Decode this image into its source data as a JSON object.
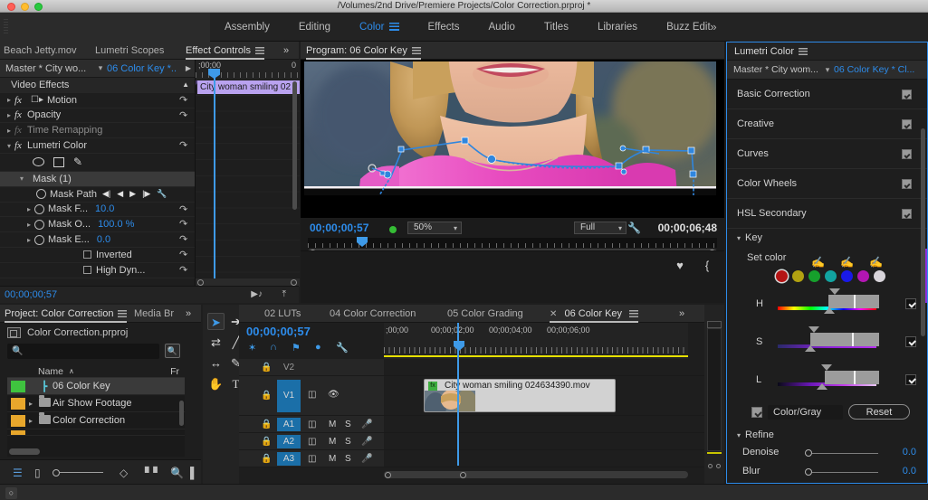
{
  "window": {
    "title": "/Volumes/2nd Drive/Premiere Projects/Color Correction.prproj *"
  },
  "workspace": {
    "tabs": [
      {
        "label": "Assembly",
        "active": false
      },
      {
        "label": "Editing",
        "active": false
      },
      {
        "label": "Color",
        "active": true
      },
      {
        "label": "Effects",
        "active": false
      },
      {
        "label": "Audio",
        "active": false
      },
      {
        "label": "Titles",
        "active": false
      },
      {
        "label": "Libraries",
        "active": false
      },
      {
        "label": "Buzz Edit",
        "active": false
      }
    ],
    "overflow": "»"
  },
  "effect_controls": {
    "tabs": [
      {
        "label": "Beach Jetty.mov",
        "active": false
      },
      {
        "label": "Lumetri Scopes",
        "active": false
      },
      {
        "label": "Effect Controls",
        "active": true
      }
    ],
    "overflow": "»",
    "master_label": "Master * City wo...",
    "sequence_label": "06 Color Key *...",
    "section_header": "Video Effects",
    "rows": [
      {
        "label": "Motion",
        "kind": "fx",
        "value": ""
      },
      {
        "label": "Opacity",
        "kind": "fx",
        "value": ""
      },
      {
        "label": "Time Remapping",
        "kind": "fx-dim",
        "value": ""
      },
      {
        "label": "Lumetri Color",
        "kind": "fx-open",
        "value": ""
      }
    ],
    "mask_label": "Mask (1)",
    "mask_path_label": "Mask Path",
    "params": [
      {
        "label": "Mask F...",
        "value": "10.0"
      },
      {
        "label": "Mask O...",
        "value": "100.0 %"
      },
      {
        "label": "Mask E...",
        "value": "0.0"
      }
    ],
    "checkboxes": [
      {
        "label": "Inverted",
        "checked": false
      },
      {
        "label": "High Dyn...",
        "checked": false
      }
    ],
    "timeline_start": ";00;00",
    "timeline_end": "0",
    "clip_label": "City woman smiling 02",
    "timecode": "00;00;00;57"
  },
  "program": {
    "tab_label": "Program: 06 Color Key",
    "timecode_left": "00;00;00;57",
    "zoom_level": "50%",
    "quality": "Full",
    "duration": "00;00;06;48",
    "buttons": [
      {
        "name": "add-marker-button",
        "glyph": "♥"
      },
      {
        "name": "mark-in-button",
        "glyph": "{"
      },
      {
        "name": "mark-out-button",
        "glyph": "}"
      },
      {
        "name": "go-to-in-button",
        "glyph": "{←"
      },
      {
        "name": "step-back-button",
        "glyph": "◀❘"
      },
      {
        "name": "play-stop-button",
        "glyph": "▶"
      },
      {
        "name": "step-forward-button",
        "glyph": "❘▶"
      },
      {
        "name": "go-to-out-button",
        "glyph": "→}"
      },
      {
        "name": "lift-button",
        "glyph": "▃"
      },
      {
        "name": "extract-button",
        "glyph": "▃"
      },
      {
        "name": "export-frame-button",
        "glyph": "▣"
      },
      {
        "name": "button-editor-overflow",
        "glyph": "»"
      },
      {
        "name": "add-button",
        "glyph": "+"
      }
    ]
  },
  "lumetri": {
    "tab_label": "Lumetri Color",
    "master_label": "Master * City wom...",
    "sequence_label": "06 Color Key * Cl...",
    "sections": [
      {
        "label": "Basic Correction",
        "checked": true
      },
      {
        "label": "Creative",
        "checked": true
      },
      {
        "label": "Curves",
        "checked": true
      },
      {
        "label": "Color Wheels",
        "checked": true
      },
      {
        "label": "HSL Secondary",
        "checked": true
      }
    ],
    "key_label": "Key",
    "set_color_label": "Set color",
    "eyedroppers": [
      "eyedropper",
      "eyedropper-add",
      "eyedropper-subtract"
    ],
    "swatches": [
      {
        "name": "red",
        "color": "#b41414",
        "selected": true
      },
      {
        "name": "yellow",
        "color": "#b2a211"
      },
      {
        "name": "green",
        "color": "#16a02c"
      },
      {
        "name": "cyan",
        "color": "#12a3a0"
      },
      {
        "name": "blue",
        "color": "#1919e8"
      },
      {
        "name": "magenta",
        "color": "#b316b3"
      },
      {
        "name": "white",
        "color": "#d8d4da"
      }
    ],
    "hsl_rows": [
      {
        "label": "H",
        "checked": true
      },
      {
        "label": "S",
        "checked": true
      },
      {
        "label": "L",
        "checked": true
      }
    ],
    "color_gray_label": "Color/Gray",
    "color_gray_checked": true,
    "reset_label": "Reset",
    "refine_label": "Refine",
    "refine_sliders": [
      {
        "label": "Denoise",
        "value": "0.0"
      },
      {
        "label": "Blur",
        "value": "0.0"
      }
    ]
  },
  "project": {
    "tabs": [
      {
        "label": "Project: Color Correction",
        "active": true
      },
      {
        "label": "Media Br",
        "active": false
      }
    ],
    "overflow": "»",
    "project_file": "Color Correction.prproj",
    "search_placeholder": "",
    "columns": {
      "name": "Name",
      "sort": "∧",
      "second": "Fr"
    },
    "items": [
      {
        "label": "06 Color Key",
        "type": "sequence",
        "swatch": "#3fc33f",
        "selected": true,
        "expandable": false
      },
      {
        "label": "Air Show Footage",
        "type": "bin",
        "swatch": "#e8a72c",
        "selected": false,
        "expandable": true
      },
      {
        "label": "Color Correction",
        "type": "bin",
        "swatch": "#e8a72c",
        "selected": false,
        "expandable": true
      }
    ],
    "footer_icons": [
      "list-view-icon",
      "icon-view-icon",
      "zoom-slider",
      "sort-icon",
      "freeform-icon",
      "find-icon",
      "new-item-icon"
    ]
  },
  "timeline": {
    "tabs": [
      {
        "label": "02 LUTs",
        "active": false,
        "closable": false
      },
      {
        "label": "04 Color Correction",
        "active": false,
        "closable": false
      },
      {
        "label": "05 Color Grading",
        "active": false,
        "closable": false
      },
      {
        "label": "06 Color Key",
        "active": true,
        "closable": true
      }
    ],
    "overflow": "»",
    "timecode": "00;00;00;57",
    "tool_icons": [
      "selection-tool",
      "track-select-forward-tool",
      "ripple-edit-tool",
      "rolling-edit-tool",
      "slip-tool",
      "pen-tool",
      "hand-tool",
      "type-tool"
    ],
    "toolbar_icons": [
      "nest-toggle-icon",
      "snap-icon",
      "linked-selection-icon",
      "add-marker-icon",
      "timeline-settings-icon"
    ],
    "ruler_labels": [
      ";00;00",
      "00;00;02;00",
      "00;00;04;00",
      "00;00;06;00"
    ],
    "tracks": [
      {
        "name": "V2",
        "type": "video",
        "enabled": false
      },
      {
        "name": "V1",
        "type": "video",
        "enabled": true
      },
      {
        "name": "A1",
        "type": "audio",
        "enabled": true
      },
      {
        "name": "A2",
        "type": "audio",
        "enabled": true
      },
      {
        "name": "A3",
        "type": "audio",
        "enabled": true
      }
    ],
    "clip": {
      "label": "City woman smiling 024634390.mov"
    }
  }
}
